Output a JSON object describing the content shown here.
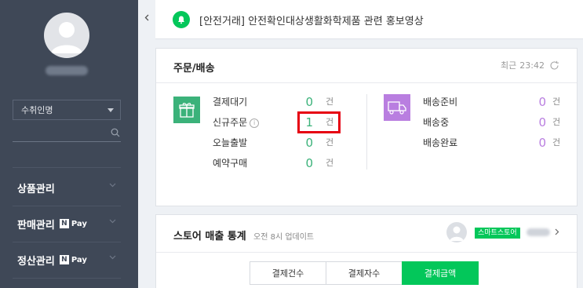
{
  "sidebar": {
    "store_select": {
      "value": "수취인명"
    },
    "menu": [
      {
        "label": "상품관리",
        "npay": false
      },
      {
        "label": "판매관리",
        "npay": true
      },
      {
        "label": "정산관리",
        "npay": true
      }
    ],
    "npay_label": "Pay",
    "npay_n": "N"
  },
  "notice": {
    "text": "[안전거래] 안전확인대상생활화학제품 관련 홍보영상"
  },
  "orders": {
    "title": "주문/배송",
    "refresh_prefix": "최근",
    "refresh_time": "23:42",
    "unit": "건",
    "left": [
      {
        "label": "결제대기",
        "count": "0"
      },
      {
        "label": "신규주문",
        "count": "1",
        "info": "i"
      },
      {
        "label": "오늘출발",
        "count": "0"
      },
      {
        "label": "예약구매",
        "count": "0"
      }
    ],
    "right": [
      {
        "label": "배송준비",
        "count": "0"
      },
      {
        "label": "배송중",
        "count": "0"
      },
      {
        "label": "배송완료",
        "count": "0"
      }
    ]
  },
  "stats": {
    "title": "스토어 매출 통계",
    "subtitle": "오전 8시 업데이트",
    "store_badge": "스마트스토어",
    "tabs": [
      {
        "label": "결제건수",
        "active": false
      },
      {
        "label": "결제자수",
        "active": false
      },
      {
        "label": "결제금액",
        "active": true
      }
    ]
  },
  "colors": {
    "brand_green": "#03c75a",
    "highlight_red": "#e60012",
    "purple": "#b97ee0",
    "sidebar_bg": "#3f4857"
  }
}
